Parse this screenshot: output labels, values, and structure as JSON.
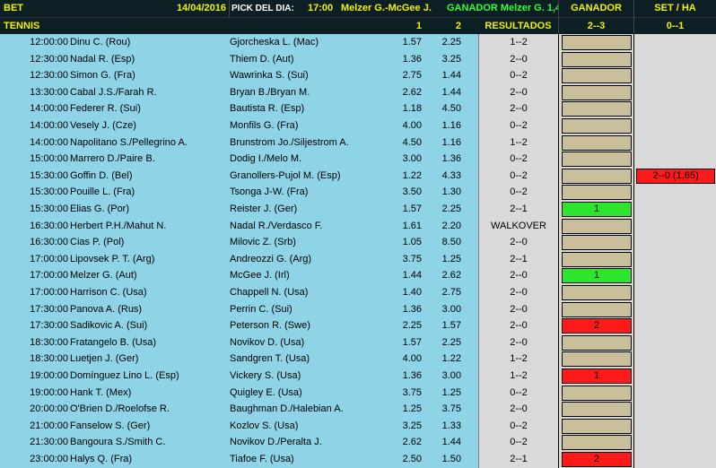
{
  "header": {
    "bet_label": "BET",
    "date": "14/04/2016",
    "pick_label": "PICK DEL DIA:",
    "pick_time": "17:00",
    "pick_match": "Melzer G.-McGee J.",
    "pick_winner": "GANADOR Melzer G. 1,44",
    "ganador_label": "GANADOR",
    "set_label": "SET / HA",
    "sport_label": "TENNIS",
    "col1": "1",
    "col2": "2",
    "resultados_label": "RESULTADOS",
    "ganador_sub": "2--3",
    "set_sub": "0--1"
  },
  "colors": {
    "header_bg": "#0b1f24",
    "header_text": "#f2f200",
    "row_bg": "#8fd3e7",
    "win": "#2ee52e",
    "loss": "#ff1a1a",
    "pending": "#c9bf9a"
  },
  "rows": [
    {
      "time": "12:00:00",
      "p1": "Dinu C. (Rou)",
      "p2": "Gjorcheska L. (Mac)",
      "o1": "1.57",
      "o2": "2.25",
      "res": "1--2",
      "gan": "",
      "gan_state": "neutral",
      "set": ""
    },
    {
      "time": "12:30:00",
      "p1": "Nadal R. (Esp)",
      "p2": "Thiem D. (Aut)",
      "o1": "1.36",
      "o2": "3.25",
      "res": "2--0",
      "gan": "",
      "gan_state": "neutral",
      "set": ""
    },
    {
      "time": "12:30:00",
      "p1": "Simon G. (Fra)",
      "p2": "Wawrinka S. (Sui)",
      "o1": "2.75",
      "o2": "1.44",
      "res": "0--2",
      "gan": "",
      "gan_state": "neutral",
      "set": ""
    },
    {
      "time": "13:30:00",
      "p1": "Cabal J.S./Farah R.",
      "p2": "Bryan B./Bryan M.",
      "o1": "2.62",
      "o2": "1.44",
      "res": "2--0",
      "gan": "",
      "gan_state": "neutral",
      "set": ""
    },
    {
      "time": "14:00:00",
      "p1": "Federer R. (Sui)",
      "p2": "Bautista R. (Esp)",
      "o1": "1.18",
      "o2": "4.50",
      "res": "2--0",
      "gan": "",
      "gan_state": "neutral",
      "set": ""
    },
    {
      "time": "14:00:00",
      "p1": "Vesely J. (Cze)",
      "p2": "Monfils G. (Fra)",
      "o1": "4.00",
      "o2": "1.16",
      "res": "0--2",
      "gan": "",
      "gan_state": "neutral",
      "set": ""
    },
    {
      "time": "14:00:00",
      "p1": "Napolitano S./Pellegrino A.",
      "p2": "Brunstrom Jo./Siljestrom A.",
      "o1": "4.50",
      "o2": "1.16",
      "res": "1--2",
      "gan": "",
      "gan_state": "neutral",
      "set": ""
    },
    {
      "time": "15:00:00",
      "p1": "Marrero D./Paire B.",
      "p2": "Dodig I./Melo M.",
      "o1": "3.00",
      "o2": "1.36",
      "res": "0--2",
      "gan": "",
      "gan_state": "neutral",
      "set": ""
    },
    {
      "time": "15:30:00",
      "p1": "Goffin D. (Bel)",
      "p2": "Granollers-Pujol M. (Esp)",
      "o1": "1.22",
      "o2": "4.33",
      "res": "0--2",
      "gan": "",
      "gan_state": "neutral",
      "set": "2--0 (1,65)"
    },
    {
      "time": "15:30:00",
      "p1": "Pouille L. (Fra)",
      "p2": "Tsonga J-W. (Fra)",
      "o1": "3.50",
      "o2": "1.30",
      "res": "0--2",
      "gan": "",
      "gan_state": "neutral",
      "set": ""
    },
    {
      "time": "15:30:00",
      "p1": "Elias G. (Por)",
      "p2": "Reister J. (Ger)",
      "o1": "1.57",
      "o2": "2.25",
      "res": "2--1",
      "gan": "1",
      "gan_state": "win",
      "set": ""
    },
    {
      "time": "16:30:00",
      "p1": "Herbert P.H./Mahut N.",
      "p2": "Nadal R./Verdasco F.",
      "o1": "1.61",
      "o2": "2.20",
      "res": "WALKOVER",
      "gan": "",
      "gan_state": "neutral",
      "set": ""
    },
    {
      "time": "16:30:00",
      "p1": "Cias P. (Pol)",
      "p2": "Milovic Z. (Srb)",
      "o1": "1.05",
      "o2": "8.50",
      "res": "2--0",
      "gan": "",
      "gan_state": "neutral",
      "set": ""
    },
    {
      "time": "17:00:00",
      "p1": "Lipovsek P. T. (Arg)",
      "p2": "Andreozzi G. (Arg)",
      "o1": "3.75",
      "o2": "1.25",
      "res": "2--1",
      "gan": "",
      "gan_state": "neutral",
      "set": ""
    },
    {
      "time": "17:00:00",
      "p1": "Melzer G. (Aut)",
      "p2": "McGee J. (Irl)",
      "o1": "1.44",
      "o2": "2.62",
      "res": "2--0",
      "gan": "1",
      "gan_state": "win",
      "set": ""
    },
    {
      "time": "17:00:00",
      "p1": "Harrison C. (Usa)",
      "p2": "Chappell N. (Usa)",
      "o1": "1.40",
      "o2": "2.75",
      "res": "2--0",
      "gan": "",
      "gan_state": "neutral",
      "set": ""
    },
    {
      "time": "17:30:00",
      "p1": "Panova A. (Rus)",
      "p2": "Perrin C. (Sui)",
      "o1": "1.36",
      "o2": "3.00",
      "res": "2--0",
      "gan": "",
      "gan_state": "neutral",
      "set": ""
    },
    {
      "time": "17:30:00",
      "p1": "Sadikovic A. (Sui)",
      "p2": "Peterson R. (Swe)",
      "o1": "2.25",
      "o2": "1.57",
      "res": "2--0",
      "gan": "2",
      "gan_state": "loss",
      "set": ""
    },
    {
      "time": "18:30:00",
      "p1": "Fratangelo B. (Usa)",
      "p2": "Novikov D. (Usa)",
      "o1": "1.57",
      "o2": "2.25",
      "res": "2--0",
      "gan": "",
      "gan_state": "neutral",
      "set": ""
    },
    {
      "time": "18:30:00",
      "p1": "Luetjen J. (Ger)",
      "p2": "Sandgren T. (Usa)",
      "o1": "4.00",
      "o2": "1.22",
      "res": "1--2",
      "gan": "",
      "gan_state": "neutral",
      "set": ""
    },
    {
      "time": "19:00:00",
      "p1": "Domínguez Lino L. (Esp)",
      "p2": "Vickery S. (Usa)",
      "o1": "1.36",
      "o2": "3.00",
      "res": "1--2",
      "gan": "1",
      "gan_state": "loss",
      "set": ""
    },
    {
      "time": "19:00:00",
      "p1": "Hank T. (Mex)",
      "p2": "Quigley E. (Usa)",
      "o1": "3.75",
      "o2": "1.25",
      "res": "0--2",
      "gan": "",
      "gan_state": "neutral",
      "set": ""
    },
    {
      "time": "20:00:00",
      "p1": "O'Brien D./Roelofse R.",
      "p2": "Baughman D./Halebian A.",
      "o1": "1.25",
      "o2": "3.75",
      "res": "2--0",
      "gan": "",
      "gan_state": "neutral",
      "set": ""
    },
    {
      "time": "21:00:00",
      "p1": "Fanselow S. (Ger)",
      "p2": "Kozlov S. (Usa)",
      "o1": "3.25",
      "o2": "1.33",
      "res": "0--2",
      "gan": "",
      "gan_state": "neutral",
      "set": ""
    },
    {
      "time": "21:30:00",
      "p1": "Bangoura S./Smith C.",
      "p2": "Novikov D./Peralta J.",
      "o1": "2.62",
      "o2": "1.44",
      "res": "0--2",
      "gan": "",
      "gan_state": "neutral",
      "set": ""
    },
    {
      "time": "23:00:00",
      "p1": "Halys Q. (Fra)",
      "p2": "Tiafoe F. (Usa)",
      "o1": "2.50",
      "o2": "1.50",
      "res": "2--1",
      "gan": "2",
      "gan_state": "loss",
      "set": ""
    }
  ]
}
